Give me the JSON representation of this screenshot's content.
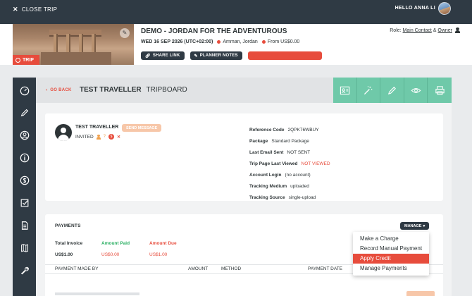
{
  "topbar": {
    "close_label": "CLOSE TRIP",
    "greeting": "HELLO ANNA LI"
  },
  "trip": {
    "badge_label": "TRIP",
    "title": "DEMO - JORDAN FOR THE ADVENTUROUS",
    "date": "WED 16 SEP 2026 (UTC+02:00)",
    "location": "Amman, Jordan",
    "price": "From US$0.00",
    "role_label": "Role:",
    "role_main": "Main Contact",
    "role_amp": "&",
    "role_owner": "Owner",
    "buttons": {
      "share": "SHARE LINK",
      "notes": "PLANNER NOTES",
      "preview": "PREVIEW AS: REGISTERED"
    }
  },
  "header": {
    "back_label": "GO BACK",
    "title_strong": "TEST TRAVELLER",
    "title_light": "TRIPBOARD"
  },
  "traveller": {
    "name": "TEST TRAVELLER",
    "send_label": "SEND MESSAGE",
    "status": "INVITED",
    "question_mark": "?",
    "dollar_glyph": "$",
    "x_glyph": "✕",
    "details": [
      {
        "label": "Reference Code",
        "value": "2QPK76WBUY",
        "alert": false
      },
      {
        "label": "Package",
        "value": "Standard Package",
        "alert": false
      },
      {
        "label": "Last Email Sent",
        "value": "NOT SENT",
        "alert": false
      },
      {
        "label": "Trip Page Last Viewed",
        "value": "NOT VIEWED",
        "alert": true
      },
      {
        "label": "Account Login",
        "value": "(no account)",
        "alert": false
      },
      {
        "label": "Tracking Medium",
        "value": "uploaded",
        "alert": false
      },
      {
        "label": "Tracking Source",
        "value": "single-upload",
        "alert": false
      }
    ]
  },
  "payments": {
    "title": "PAYMENTS",
    "manage_label": "MANAGE",
    "total_invoice_label": "Total Invoice",
    "total_invoice_value": "US$1.00",
    "amount_paid_label": "Amount Paid",
    "amount_paid_value": "US$0.00",
    "amount_due_label": "Amount Due",
    "amount_due_value": "US$1.00",
    "columns": [
      "PAYMENT MADE BY",
      "AMOUNT",
      "METHOD",
      "PAYMENT DATE"
    ]
  },
  "dropdown": {
    "items": [
      "Make a Charge",
      "Record Manual Payment",
      "Apply Credit",
      "Manage Payments"
    ],
    "active_index": 2
  },
  "colors": {
    "dark": "#2f3a44",
    "accent_red": "#e74c3c",
    "mint": "#6fc9a9",
    "green": "#27ae60"
  }
}
